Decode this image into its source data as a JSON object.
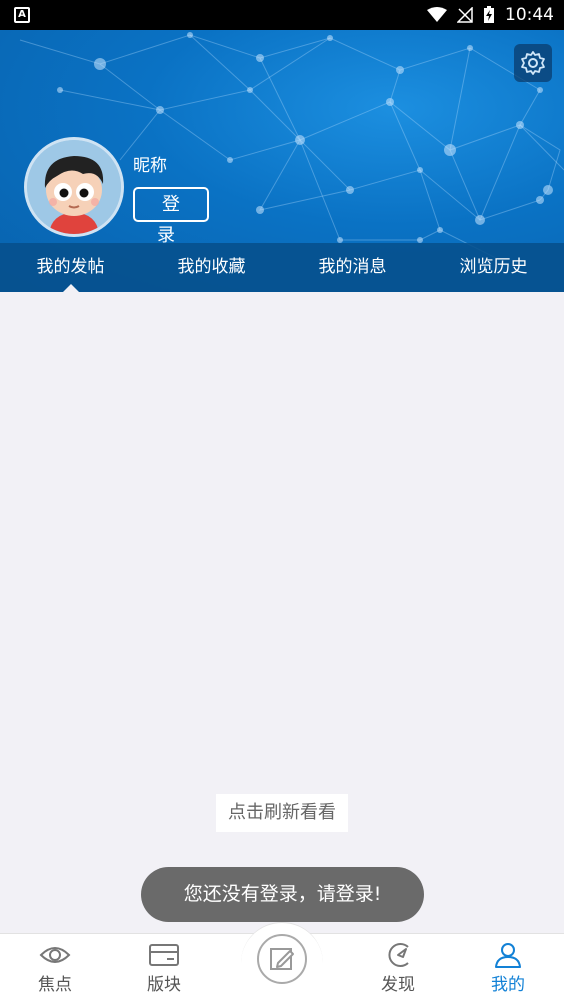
{
  "status_bar": {
    "time": "10:44",
    "app_icon_letter": "A"
  },
  "header": {
    "nickname": "昵称",
    "login_label": "登 录"
  },
  "tabs": [
    {
      "label": "我的发帖",
      "active": true
    },
    {
      "label": "我的收藏",
      "active": false
    },
    {
      "label": "我的消息",
      "active": false
    },
    {
      "label": "浏览历史",
      "active": false
    }
  ],
  "content": {
    "refresh_label": "点击刷新看看"
  },
  "toast": {
    "message": "您还没有登录，请登录!"
  },
  "bottom_nav": {
    "items": [
      {
        "label": "焦点",
        "icon": "eye-icon"
      },
      {
        "label": "版块",
        "icon": "card-icon"
      },
      {
        "label": "",
        "icon": "edit-icon"
      },
      {
        "label": "发现",
        "icon": "compass-icon"
      },
      {
        "label": "我的",
        "icon": "user-icon",
        "active": true
      }
    ]
  },
  "colors": {
    "header_blue": "#0a72c4",
    "accent": "#1281d6",
    "toast_bg": "#6a6a6a"
  }
}
